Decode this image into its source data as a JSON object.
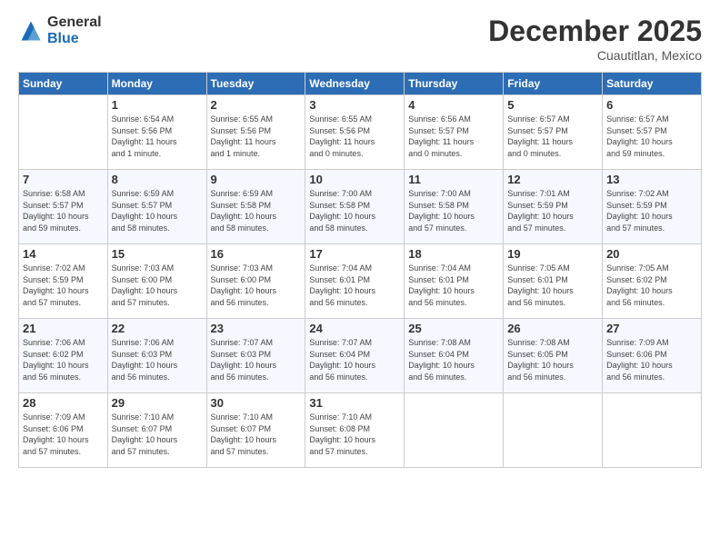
{
  "logo": {
    "general": "General",
    "blue": "Blue"
  },
  "title": "December 2025",
  "location": "Cuautitlan, Mexico",
  "days_header": [
    "Sunday",
    "Monday",
    "Tuesday",
    "Wednesday",
    "Thursday",
    "Friday",
    "Saturday"
  ],
  "weeks": [
    [
      {
        "day": "",
        "info": ""
      },
      {
        "day": "1",
        "info": "Sunrise: 6:54 AM\nSunset: 5:56 PM\nDaylight: 11 hours\nand 1 minute."
      },
      {
        "day": "2",
        "info": "Sunrise: 6:55 AM\nSunset: 5:56 PM\nDaylight: 11 hours\nand 1 minute."
      },
      {
        "day": "3",
        "info": "Sunrise: 6:55 AM\nSunset: 5:56 PM\nDaylight: 11 hours\nand 0 minutes."
      },
      {
        "day": "4",
        "info": "Sunrise: 6:56 AM\nSunset: 5:57 PM\nDaylight: 11 hours\nand 0 minutes."
      },
      {
        "day": "5",
        "info": "Sunrise: 6:57 AM\nSunset: 5:57 PM\nDaylight: 11 hours\nand 0 minutes."
      },
      {
        "day": "6",
        "info": "Sunrise: 6:57 AM\nSunset: 5:57 PM\nDaylight: 10 hours\nand 59 minutes."
      }
    ],
    [
      {
        "day": "7",
        "info": "Sunrise: 6:58 AM\nSunset: 5:57 PM\nDaylight: 10 hours\nand 59 minutes."
      },
      {
        "day": "8",
        "info": "Sunrise: 6:59 AM\nSunset: 5:57 PM\nDaylight: 10 hours\nand 58 minutes."
      },
      {
        "day": "9",
        "info": "Sunrise: 6:59 AM\nSunset: 5:58 PM\nDaylight: 10 hours\nand 58 minutes."
      },
      {
        "day": "10",
        "info": "Sunrise: 7:00 AM\nSunset: 5:58 PM\nDaylight: 10 hours\nand 58 minutes."
      },
      {
        "day": "11",
        "info": "Sunrise: 7:00 AM\nSunset: 5:58 PM\nDaylight: 10 hours\nand 57 minutes."
      },
      {
        "day": "12",
        "info": "Sunrise: 7:01 AM\nSunset: 5:59 PM\nDaylight: 10 hours\nand 57 minutes."
      },
      {
        "day": "13",
        "info": "Sunrise: 7:02 AM\nSunset: 5:59 PM\nDaylight: 10 hours\nand 57 minutes."
      }
    ],
    [
      {
        "day": "14",
        "info": "Sunrise: 7:02 AM\nSunset: 5:59 PM\nDaylight: 10 hours\nand 57 minutes."
      },
      {
        "day": "15",
        "info": "Sunrise: 7:03 AM\nSunset: 6:00 PM\nDaylight: 10 hours\nand 57 minutes."
      },
      {
        "day": "16",
        "info": "Sunrise: 7:03 AM\nSunset: 6:00 PM\nDaylight: 10 hours\nand 56 minutes."
      },
      {
        "day": "17",
        "info": "Sunrise: 7:04 AM\nSunset: 6:01 PM\nDaylight: 10 hours\nand 56 minutes."
      },
      {
        "day": "18",
        "info": "Sunrise: 7:04 AM\nSunset: 6:01 PM\nDaylight: 10 hours\nand 56 minutes."
      },
      {
        "day": "19",
        "info": "Sunrise: 7:05 AM\nSunset: 6:01 PM\nDaylight: 10 hours\nand 56 minutes."
      },
      {
        "day": "20",
        "info": "Sunrise: 7:05 AM\nSunset: 6:02 PM\nDaylight: 10 hours\nand 56 minutes."
      }
    ],
    [
      {
        "day": "21",
        "info": "Sunrise: 7:06 AM\nSunset: 6:02 PM\nDaylight: 10 hours\nand 56 minutes."
      },
      {
        "day": "22",
        "info": "Sunrise: 7:06 AM\nSunset: 6:03 PM\nDaylight: 10 hours\nand 56 minutes."
      },
      {
        "day": "23",
        "info": "Sunrise: 7:07 AM\nSunset: 6:03 PM\nDaylight: 10 hours\nand 56 minutes."
      },
      {
        "day": "24",
        "info": "Sunrise: 7:07 AM\nSunset: 6:04 PM\nDaylight: 10 hours\nand 56 minutes."
      },
      {
        "day": "25",
        "info": "Sunrise: 7:08 AM\nSunset: 6:04 PM\nDaylight: 10 hours\nand 56 minutes."
      },
      {
        "day": "26",
        "info": "Sunrise: 7:08 AM\nSunset: 6:05 PM\nDaylight: 10 hours\nand 56 minutes."
      },
      {
        "day": "27",
        "info": "Sunrise: 7:09 AM\nSunset: 6:06 PM\nDaylight: 10 hours\nand 56 minutes."
      }
    ],
    [
      {
        "day": "28",
        "info": "Sunrise: 7:09 AM\nSunset: 6:06 PM\nDaylight: 10 hours\nand 57 minutes."
      },
      {
        "day": "29",
        "info": "Sunrise: 7:10 AM\nSunset: 6:07 PM\nDaylight: 10 hours\nand 57 minutes."
      },
      {
        "day": "30",
        "info": "Sunrise: 7:10 AM\nSunset: 6:07 PM\nDaylight: 10 hours\nand 57 minutes."
      },
      {
        "day": "31",
        "info": "Sunrise: 7:10 AM\nSunset: 6:08 PM\nDaylight: 10 hours\nand 57 minutes."
      },
      {
        "day": "",
        "info": ""
      },
      {
        "day": "",
        "info": ""
      },
      {
        "day": "",
        "info": ""
      }
    ]
  ]
}
